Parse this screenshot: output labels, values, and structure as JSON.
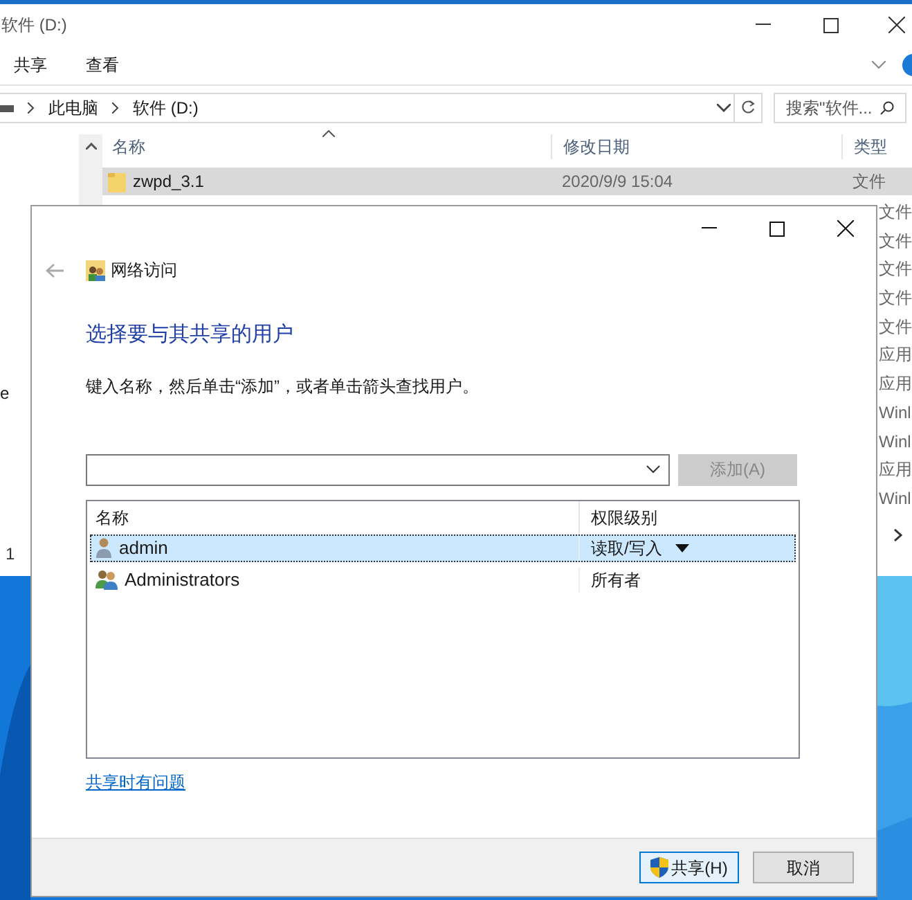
{
  "explorer": {
    "title": "软件 (D:)",
    "ribbon_tabs": [
      "共享",
      "查看"
    ],
    "breadcrumb": [
      "此电脑",
      "软件 (D:)"
    ],
    "search": {
      "placeholder": "搜索\"软件..."
    },
    "columns": [
      "名称",
      "修改日期",
      "类型"
    ],
    "rows": [
      {
        "name": "zwpd_3.1",
        "date": "2020/9/9 15:04",
        "type": "文件",
        "selected": true
      }
    ],
    "type_cells": [
      "文件",
      "文件",
      "文件",
      "文件",
      "文件",
      "应用",
      "应用",
      "Winl",
      "Winl",
      "应用",
      "Winl"
    ],
    "nav_fragment": "e",
    "status": "1"
  },
  "dialog": {
    "title": "网络访问",
    "heading": "选择要与其共享的用户",
    "instruction": "键入名称，然后单击“添加”，或者单击箭头查找用户。",
    "add_button": {
      "label": "添加(A)",
      "disabled": true
    },
    "columns": [
      "名称",
      "权限级别"
    ],
    "users": [
      {
        "name": "admin",
        "permission": "读取/写入",
        "kind": "user",
        "selected": true
      },
      {
        "name": "Administrators",
        "permission": "所有者",
        "kind": "group",
        "selected": false
      }
    ],
    "help_link": "共享时有问题",
    "buttons": [
      {
        "label": "共享(H)",
        "kind": "primary"
      },
      {
        "label": "取消",
        "kind": "normal"
      }
    ]
  }
}
